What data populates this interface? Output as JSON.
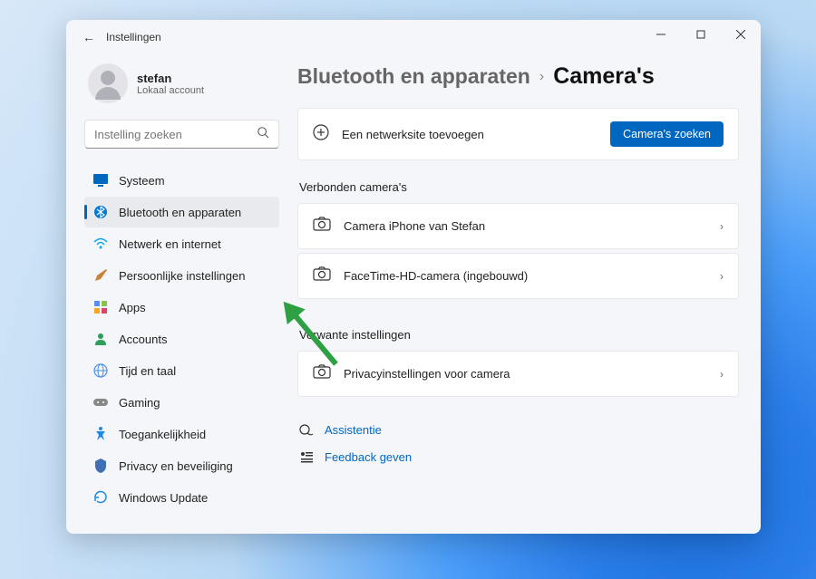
{
  "titlebar": {
    "title": "Instellingen"
  },
  "user": {
    "name": "stefan",
    "sub": "Lokaal account"
  },
  "search": {
    "placeholder": "Instelling zoeken"
  },
  "nav": [
    {
      "label": "Systeem"
    },
    {
      "label": "Bluetooth en apparaten"
    },
    {
      "label": "Netwerk en internet"
    },
    {
      "label": "Persoonlijke instellingen"
    },
    {
      "label": "Apps"
    },
    {
      "label": "Accounts"
    },
    {
      "label": "Tijd en taal"
    },
    {
      "label": "Gaming"
    },
    {
      "label": "Toegankelijkheid"
    },
    {
      "label": "Privacy en beveiliging"
    },
    {
      "label": "Windows Update"
    }
  ],
  "breadcrumb": {
    "parent": "Bluetooth en apparaten",
    "current": "Camera's"
  },
  "addRow": {
    "label": "Een netwerksite toevoegen",
    "button": "Camera's zoeken"
  },
  "sections": {
    "connected": {
      "title": "Verbonden camera's",
      "items": [
        {
          "label": "Camera iPhone van Stefan"
        },
        {
          "label": "FaceTime-HD-camera (ingebouwd)"
        }
      ]
    },
    "related": {
      "title": "Verwante instellingen",
      "items": [
        {
          "label": "Privacyinstellingen voor camera"
        }
      ]
    }
  },
  "links": {
    "help": "Assistentie",
    "feedback": "Feedback geven"
  }
}
